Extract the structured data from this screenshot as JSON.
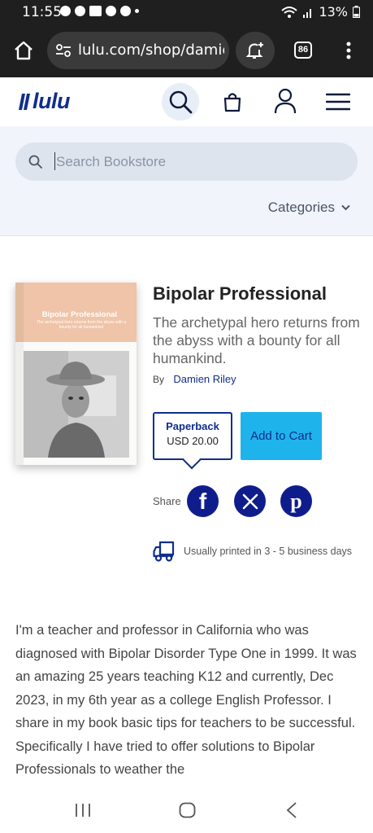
{
  "status_bar": {
    "time": "11:55",
    "battery": "13%"
  },
  "browser": {
    "url": "lulu.com/shop/damie",
    "tab_count": "86"
  },
  "site": {
    "logo_text": "lulu",
    "brand_color": "#0f2e8c"
  },
  "search": {
    "placeholder": "Search Bookstore",
    "categories_label": "Categories"
  },
  "book": {
    "cover_title": "Bipolar Professional",
    "cover_subtitle": "The archetypal hero returns from the abyss with a bounty for all humankind",
    "title": "Bipolar Professional",
    "subtitle": "The archetypal hero returns from the abyss with a bounty for all humankind.",
    "by_label": "By",
    "author": "Damien Riley"
  },
  "purchase": {
    "format_name": "Paperback",
    "format_price": "USD 20.00",
    "add_to_cart_label": "Add to Cart",
    "accent_color": "#1fb3ec"
  },
  "share": {
    "label": "Share",
    "networks": [
      "facebook-icon",
      "x-icon",
      "pinterest-icon"
    ]
  },
  "shipping": {
    "text": "Usually printed in 3 - 5 business days"
  },
  "description": {
    "text": "I'm a teacher and professor in California who was diagnosed with Bipolar Disorder Type One in 1999. It was an amazing 25 years teaching K12 and currently, Dec 2023, in my 6th year as a college English Professor. I share in my book basic tips for teachers to be successful. Specifically I have tried to offer solutions to Bipolar Professionals to weather the"
  }
}
